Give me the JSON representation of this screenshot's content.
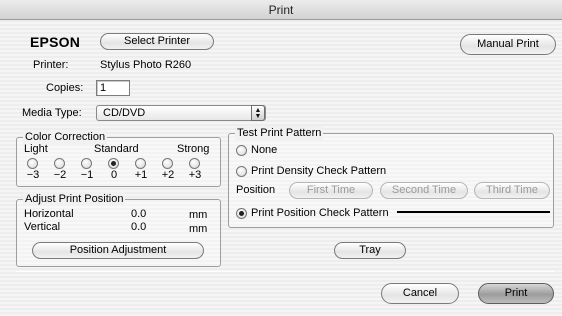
{
  "window": {
    "title": "Print"
  },
  "header": {
    "brand": "EPSON",
    "select_printer": "Select Printer",
    "manual_print": "Manual Print"
  },
  "printer": {
    "label": "Printer:",
    "value": "Stylus Photo R260"
  },
  "copies": {
    "label": "Copies:",
    "value": "1"
  },
  "media": {
    "label": "Media Type:",
    "value": "CD/DVD"
  },
  "color_correction": {
    "title": "Color Correction",
    "labels": {
      "light": "Light",
      "standard": "Standard",
      "strong": "Strong"
    },
    "options": [
      "−3",
      "−2",
      "−1",
      "0",
      "+1",
      "+2",
      "+3"
    ],
    "selected": "0"
  },
  "adjust_position": {
    "title": "Adjust Print Position",
    "horizontal": {
      "label": "Horizontal",
      "value": "0.0",
      "unit": "mm"
    },
    "vertical": {
      "label": "Vertical",
      "value": "0.0",
      "unit": "mm"
    },
    "button": "Position Adjustment"
  },
  "test_pattern": {
    "title": "Test Print Pattern",
    "none": "None",
    "density": "Print Density Check Pattern",
    "position_label": "Position",
    "first": "First Time",
    "second": "Second Time",
    "third": "Third Time",
    "position_check": "Print Position Check Pattern",
    "selected": "position_check"
  },
  "tray": "Tray",
  "footer": {
    "cancel": "Cancel",
    "print": "Print"
  }
}
